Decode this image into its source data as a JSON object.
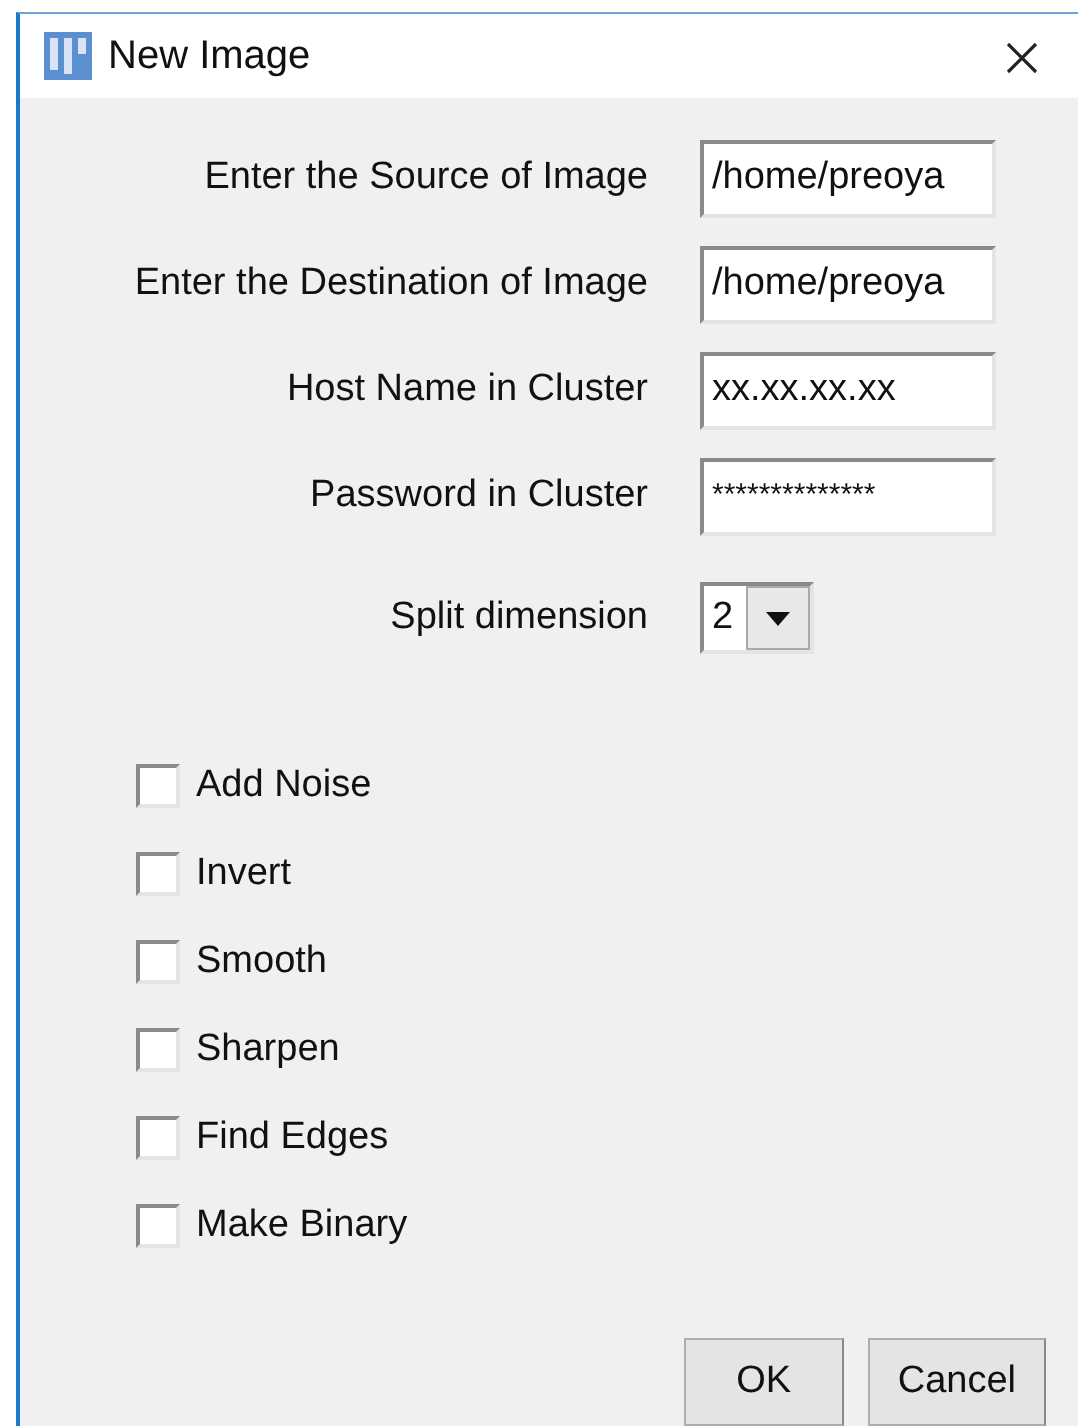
{
  "window": {
    "title": "New Image"
  },
  "fields": [
    {
      "label": "Enter the Source of Image",
      "value": "/home/preoya"
    },
    {
      "label": "Enter the Destination of Image",
      "value": "/home/preoya"
    },
    {
      "label": "Host Name in Cluster",
      "value": "xx.xx.xx.xx"
    },
    {
      "label": "Password in Cluster",
      "value": "**************"
    }
  ],
  "split": {
    "label": "Split dimension",
    "value": "2"
  },
  "options": [
    {
      "label": "Add Noise",
      "checked": false
    },
    {
      "label": "Invert",
      "checked": false
    },
    {
      "label": "Smooth",
      "checked": false
    },
    {
      "label": "Sharpen",
      "checked": false
    },
    {
      "label": "Find Edges",
      "checked": false
    },
    {
      "label": "Make Binary",
      "checked": false
    }
  ],
  "buttons": [
    "OK",
    "Cancel"
  ]
}
